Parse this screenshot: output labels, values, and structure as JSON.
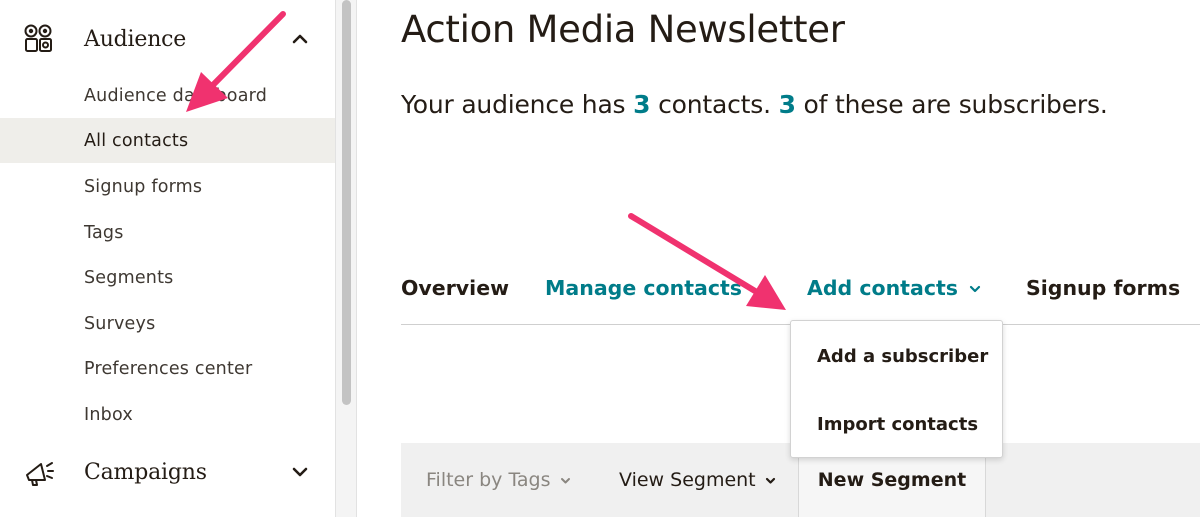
{
  "sidebar": {
    "audience_label": "Audience",
    "audience_icon": "audience-icon",
    "items": [
      {
        "label": "Audience dashboard"
      },
      {
        "label": "All contacts"
      },
      {
        "label": "Signup forms"
      },
      {
        "label": "Tags"
      },
      {
        "label": "Segments"
      },
      {
        "label": "Surveys"
      },
      {
        "label": "Preferences center"
      },
      {
        "label": "Inbox"
      }
    ],
    "active_item": "All contacts",
    "campaigns_label": "Campaigns",
    "campaigns_icon": "megaphone-icon"
  },
  "main": {
    "title": "Action Media Newsletter",
    "summary": {
      "prefix": "Your audience has ",
      "contacts_count": "3",
      "middle": " contacts. ",
      "subscribers_count": "3",
      "suffix": " of these are subscribers."
    },
    "tabs": [
      {
        "label": "Overview"
      },
      {
        "label": "Manage contacts"
      },
      {
        "label": "Add contacts"
      },
      {
        "label": "Signup forms"
      }
    ],
    "add_contacts_menu": [
      {
        "label": "Add a subscriber"
      },
      {
        "label": "Import contacts"
      }
    ],
    "filterbar": {
      "filter_tags": "Filter by Tags",
      "view_segment": "View Segment",
      "new_segment": "New Segment"
    }
  },
  "colors": {
    "accent_teal": "#007c89",
    "text_dark": "#241c15",
    "annotation_arrow": "#f0326f",
    "active_bg": "#efeeea"
  }
}
